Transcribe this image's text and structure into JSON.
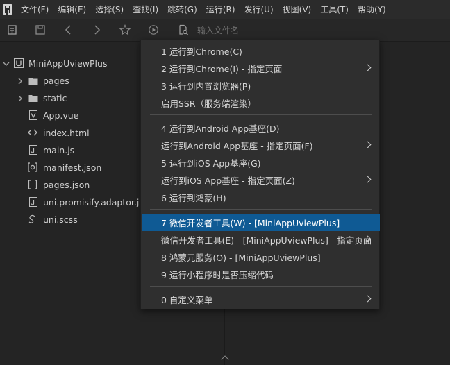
{
  "menubar": {
    "items": [
      "文件(F)",
      "编辑(E)",
      "选择(S)",
      "查找(I)",
      "跳转(G)",
      "运行(R)",
      "发行(U)",
      "视图(V)",
      "工具(T)",
      "帮助(Y)"
    ]
  },
  "toolbar": {
    "search_placeholder": "输入文件名"
  },
  "project": {
    "name": "MiniAppUviewPlus",
    "items": [
      {
        "label": "pages",
        "icon": "folder-icon"
      },
      {
        "label": "static",
        "icon": "folder-icon"
      },
      {
        "label": "App.vue",
        "icon": "vue-file-icon"
      },
      {
        "label": "index.html",
        "icon": "html-file-icon"
      },
      {
        "label": "main.js",
        "icon": "js-file-icon"
      },
      {
        "label": "manifest.json",
        "icon": "manifest-file-icon"
      },
      {
        "label": "pages.json",
        "icon": "json-file-icon"
      },
      {
        "label": "uni.promisify.adaptor.js",
        "icon": "js-file-icon"
      },
      {
        "label": "uni.scss",
        "icon": "scss-file-icon"
      }
    ]
  },
  "context_menu": {
    "items": [
      {
        "label": "1 运行到Chrome(C)",
        "submenu": false,
        "active": false
      },
      {
        "label": "2 运行到Chrome(I) - 指定页面",
        "submenu": true,
        "active": false
      },
      {
        "label": "3 运行到内置浏览器(P)",
        "submenu": false,
        "active": false
      },
      {
        "label": "启用SSR（服务端渲染）",
        "submenu": false,
        "active": false
      },
      {
        "label": "4 运行到Android App基座(D)",
        "submenu": false,
        "active": false
      },
      {
        "label": "运行到Android App基座 - 指定页面(F)",
        "submenu": true,
        "active": false
      },
      {
        "label": "5 运行到iOS App基座(G)",
        "submenu": false,
        "active": false
      },
      {
        "label": "运行到iOS App基座 - 指定页面(Z)",
        "submenu": true,
        "active": false
      },
      {
        "label": "6 运行到鸿蒙(H)",
        "submenu": false,
        "active": false
      },
      {
        "label": "7 微信开发者工具(W) - [MiniAppUviewPlus]",
        "submenu": false,
        "active": true
      },
      {
        "label": "微信开发者工具(E) - [MiniAppUviewPlus] - 指定页面",
        "submenu": true,
        "active": false
      },
      {
        "label": "8 鸿蒙元服务(O) - [MiniAppUviewPlus]",
        "submenu": false,
        "active": false
      },
      {
        "label": "9 运行小程序时是否压缩代码",
        "submenu": false,
        "active": false
      },
      {
        "label": "0 自定义菜单",
        "submenu": true,
        "active": false
      }
    ]
  },
  "colors": {
    "highlight": "#0f5a94",
    "menu_bg": "#2f2f2f",
    "editor_bg": "#242424"
  }
}
